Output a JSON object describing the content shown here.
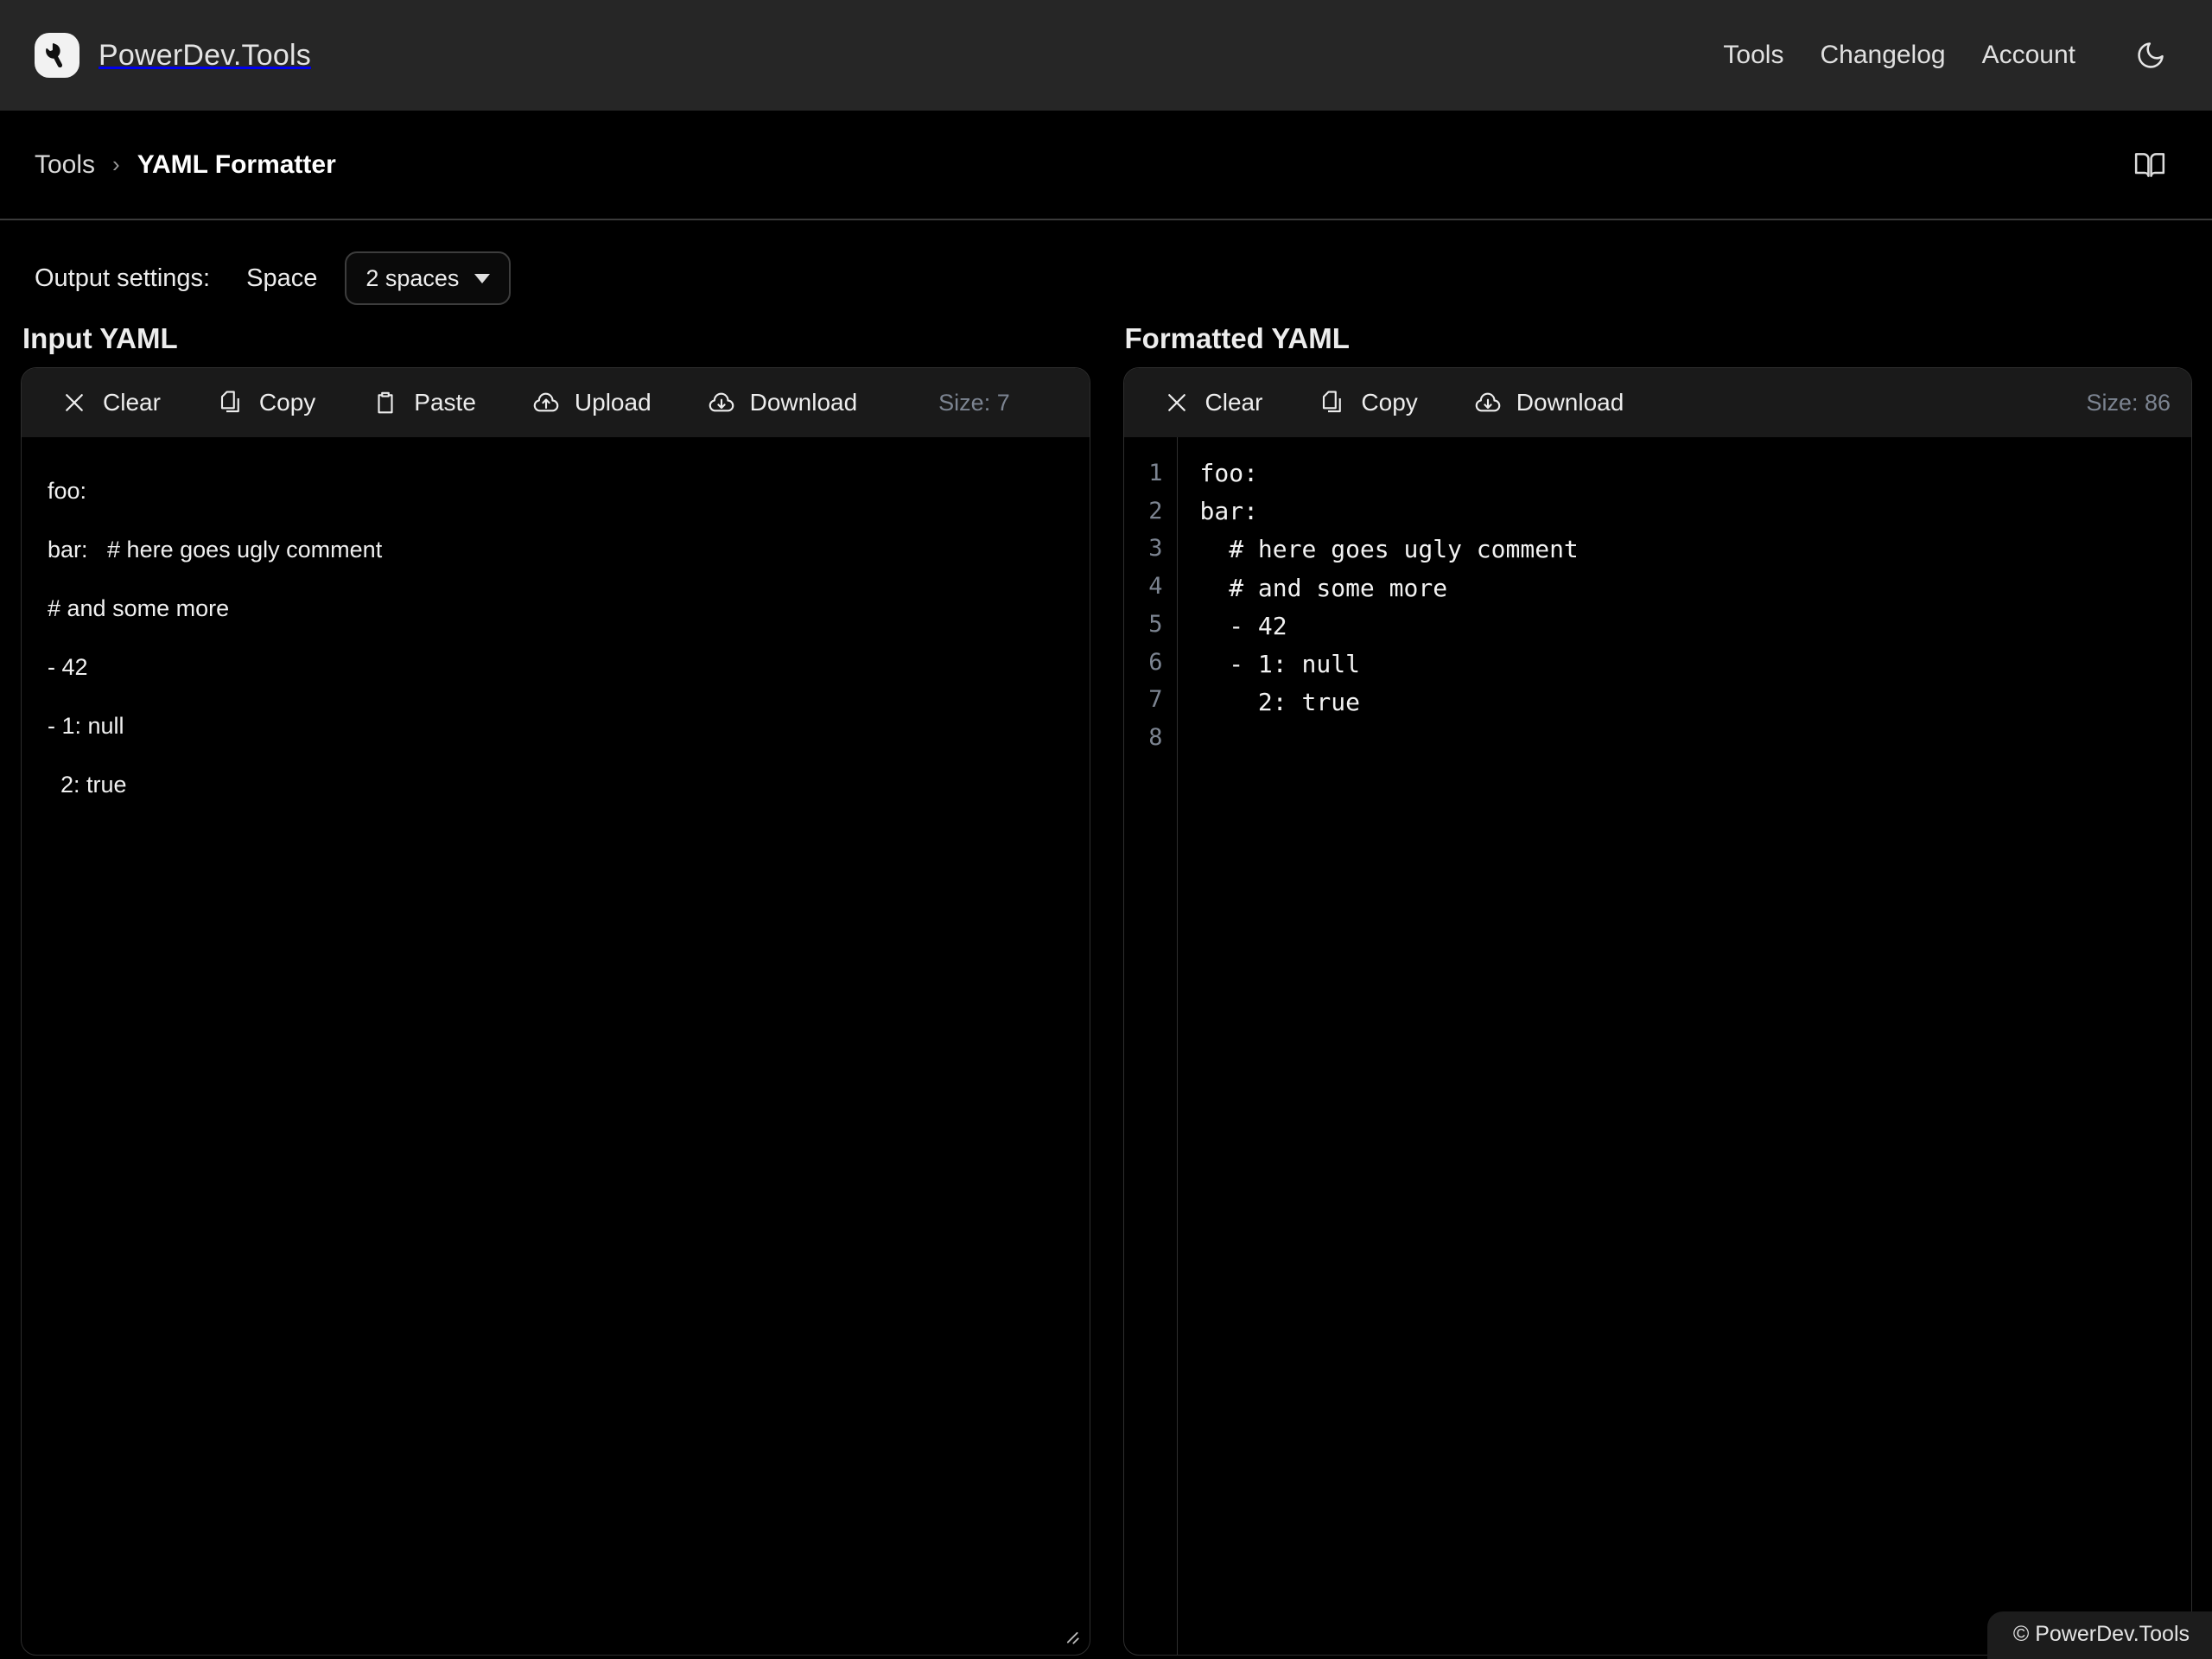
{
  "header": {
    "brand": "PowerDev.Tools",
    "logo_icon": "wrench-icon",
    "nav": [
      {
        "label": "Tools"
      },
      {
        "label": "Changelog"
      },
      {
        "label": "Account"
      }
    ],
    "theme_toggle_icon": "moon-icon"
  },
  "breadcrumb": {
    "parent": "Tools",
    "separator": "›",
    "current": "YAML Formatter",
    "docs_icon": "book-icon"
  },
  "settings": {
    "label": "Output settings:",
    "space_label": "Space",
    "indent_value": "2 spaces"
  },
  "input_panel": {
    "title": "Input YAML",
    "buttons": [
      {
        "label": "Clear",
        "icon": "close-icon"
      },
      {
        "label": "Copy",
        "icon": "copy-icon"
      },
      {
        "label": "Paste",
        "icon": "clipboard-icon"
      },
      {
        "label": "Upload",
        "icon": "cloud-upload-icon"
      },
      {
        "label": "Download",
        "icon": "cloud-download-icon"
      }
    ],
    "size_label": "Size: 7",
    "content": "foo:\nbar:   # here goes ugly comment\n# and some more\n- 42\n- 1: null\n  2: true"
  },
  "output_panel": {
    "title": "Formatted YAML",
    "buttons": [
      {
        "label": "Clear",
        "icon": "close-icon"
      },
      {
        "label": "Copy",
        "icon": "copy-icon"
      },
      {
        "label": "Download",
        "icon": "cloud-download-icon"
      }
    ],
    "size_label": "Size: 86",
    "line_numbers": "1\n2\n3\n4\n5\n6\n7\n8",
    "content": "foo:\nbar:\n  # here goes ugly comment\n  # and some more\n  - 42\n  - 1: null\n    2: true"
  },
  "footer": {
    "text": "© PowerDev.Tools"
  },
  "colors": {
    "page_bg": "#000000",
    "header_bg": "#262626",
    "toolbar_bg": "#1a1a1a",
    "border": "#2e2e2e",
    "muted_text": "#7c8491",
    "text": "#ededed"
  }
}
